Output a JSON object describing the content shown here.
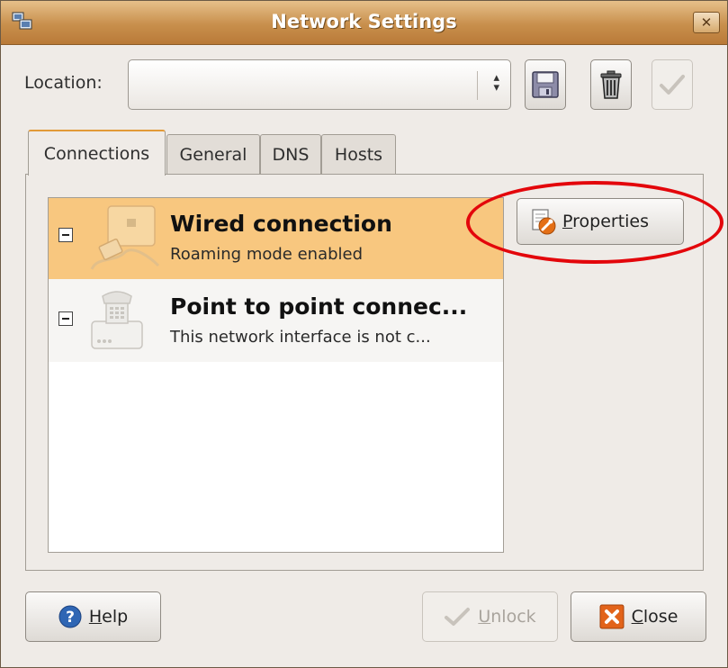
{
  "window": {
    "title": "Network Settings",
    "close_symbol": "✕"
  },
  "location": {
    "label": "Location:",
    "value": ""
  },
  "toolbar": {
    "save_icon": "floppy-disk-icon",
    "delete_icon": "trash-can-icon",
    "apply_icon": "checkmark-icon"
  },
  "tabs": [
    {
      "label": "Connections",
      "active": true
    },
    {
      "label": "General",
      "active": false
    },
    {
      "label": "DNS",
      "active": false
    },
    {
      "label": "Hosts",
      "active": false
    }
  ],
  "connections": [
    {
      "name": "Wired connection",
      "description": "Roaming mode enabled",
      "selected": true,
      "icon": "wired-network-icon"
    },
    {
      "name": "Point to point connec...",
      "description": "This network interface is not c...",
      "selected": false,
      "icon": "telephone-modem-icon"
    }
  ],
  "properties_button": {
    "mnemonic": "P",
    "rest": "roperties"
  },
  "buttons": {
    "help": {
      "mnemonic": "H",
      "rest": "elp"
    },
    "unlock": {
      "mnemonic": "U",
      "rest": "nlock",
      "enabled": false
    },
    "close": {
      "mnemonic": "C",
      "rest": "lose"
    }
  },
  "colors": {
    "titlebar": "#c88f4c",
    "selection": "#f8c77f",
    "highlight_ellipse": "#e3060b"
  }
}
